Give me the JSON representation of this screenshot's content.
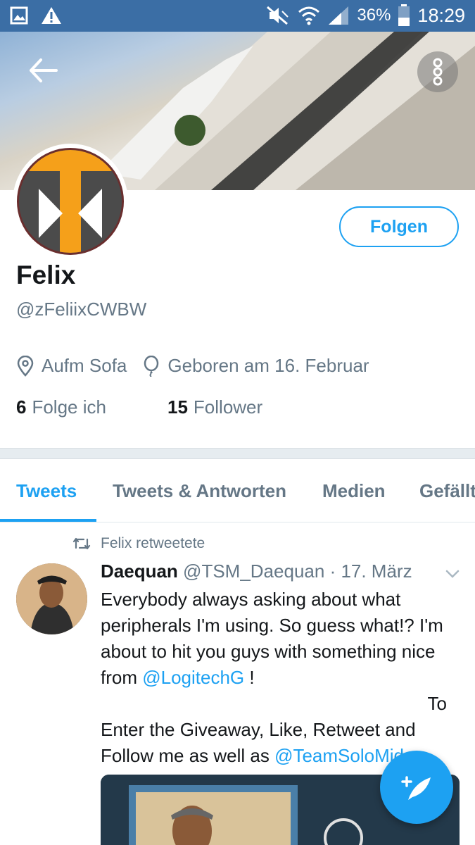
{
  "status_bar": {
    "battery_percent": "36%",
    "time": "18:29",
    "icons": [
      "gallery-icon",
      "warning-icon",
      "mute-icon",
      "wifi-icon",
      "signal-icon",
      "battery-icon"
    ]
  },
  "profile": {
    "name": "Felix",
    "handle": "@zFeliixCWBW",
    "follow_label": "Folgen",
    "location": "Aufm Sofa",
    "birthday": "Geboren am 16. Februar",
    "following_count": "6",
    "following_label": "Folge ich",
    "followers_count": "15",
    "followers_label": "Follower"
  },
  "tabs": [
    {
      "label": "Tweets",
      "active": true
    },
    {
      "label": "Tweets & Antworten",
      "active": false
    },
    {
      "label": "Medien",
      "active": false
    },
    {
      "label": "Gefällt",
      "active": false
    }
  ],
  "tweet": {
    "retweeted_by": "Felix retweetete",
    "author_name": "Daequan",
    "author_handle": "@TSM_Daequan",
    "date": "· 17. März",
    "text_1": "Everybody always asking about what peripherals I'm using. So guess what!? I'm about to hit you guys with something nice from ",
    "mention_1": "@LogitechG",
    "text_2": " !",
    "text_3": "To",
    "text_4": "Enter the Giveaway, Like, Retweet and Follow me as well as ",
    "mention_2": "@TeamSoloMid"
  },
  "colors": {
    "accent": "#1da1f2",
    "status_bar": "#3b6ea5",
    "secondary_text": "#657786"
  }
}
